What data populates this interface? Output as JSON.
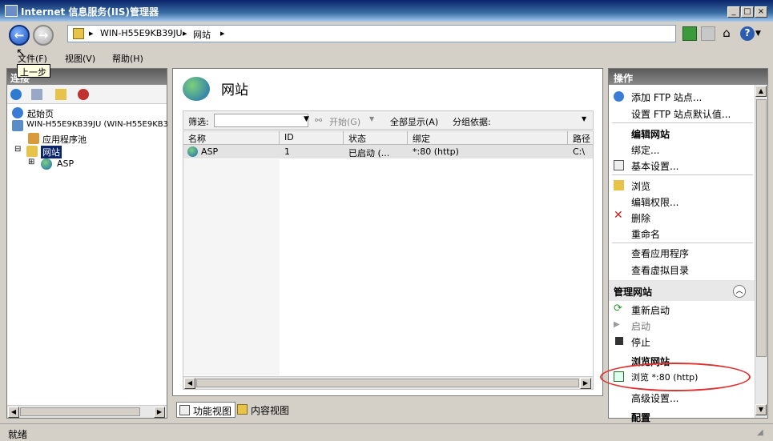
{
  "window": {
    "title": "Internet 信息服务(IIS)管理器"
  },
  "address": {
    "server": "WIN-H55E9KB39JU",
    "site": "网站"
  },
  "menu": [
    "文件(F)",
    "视图(V)",
    "帮助(H)"
  ],
  "tooltip": "上一步",
  "connections": {
    "header": "连接",
    "tree": [
      "起始页",
      "WIN-H55E9KB39JU (WIN-H55E9KB3",
      "应用程序池",
      "网站",
      "ASP"
    ]
  },
  "center": {
    "title": "网站",
    "filter_label": "筛选:",
    "start_label": "开始(G)",
    "show_all_label": "全部显示(A)",
    "group_label": "分组依据:",
    "columns": [
      "名称",
      "ID",
      "状态",
      "绑定",
      "路径"
    ],
    "rows": [
      {
        "name": "ASP",
        "id": "1",
        "status": "已启动 (...",
        "binding": "*:80 (http)",
        "path": "C:\\"
      }
    ]
  },
  "view_tabs": {
    "features": "功能视图",
    "content": "内容视图"
  },
  "actions": {
    "header": "操作",
    "items": [
      "添加 FTP 站点...",
      "设置 FTP 站点默认值...",
      "编辑网站",
      "绑定...",
      "基本设置...",
      "浏览",
      "编辑权限...",
      "删除",
      "重命名",
      "查看应用程序",
      "查看虚拟目录",
      "管理网站",
      "重新启动",
      "启动",
      "停止",
      "浏览网站",
      "浏览 *:80 (http)",
      "高级设置...",
      "配置"
    ]
  },
  "status": "就绪"
}
